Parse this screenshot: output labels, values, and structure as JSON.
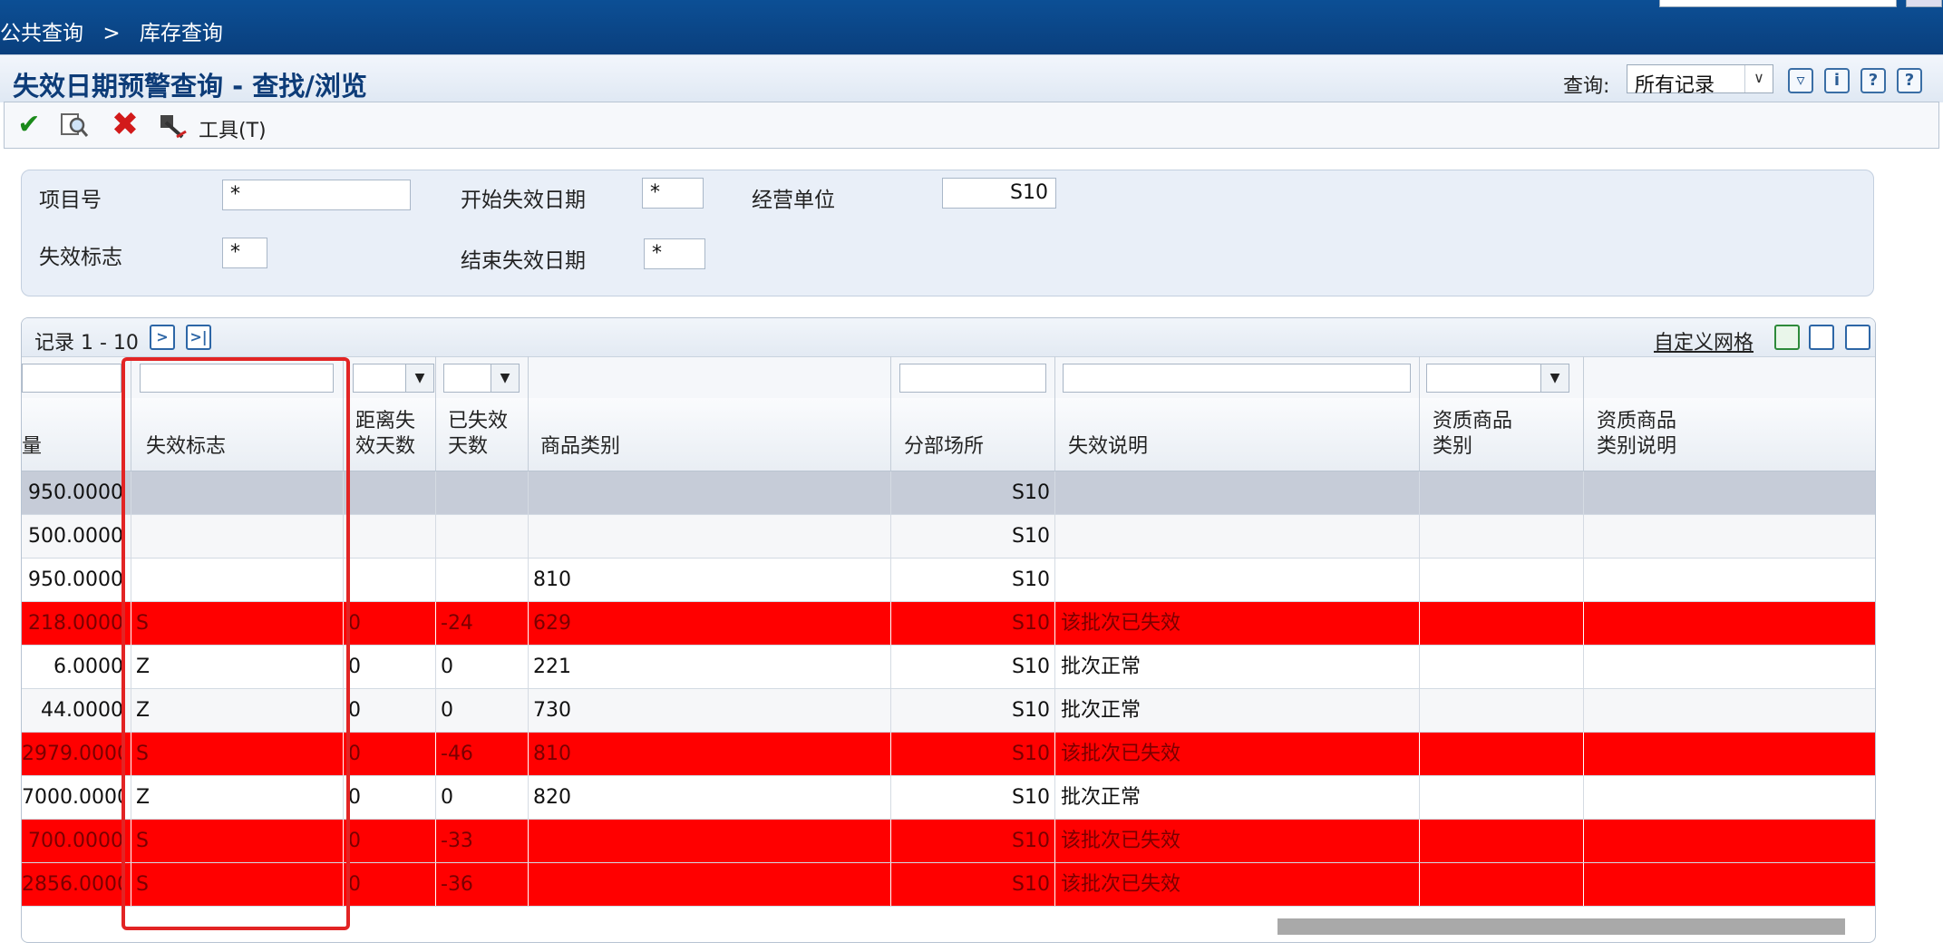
{
  "breadcrumb": {
    "parent": "公共查询",
    "separator": ">",
    "current": "库存查询"
  },
  "form": {
    "title": "失效日期预警查询 - 查找/浏览",
    "query_label": "查询:",
    "query_value": "所有记录",
    "header_icons": [
      "filter-icon",
      "info-icon",
      "help-icon",
      "context-help-icon"
    ]
  },
  "toolbar": {
    "tools_label": "工具(T)"
  },
  "filters": {
    "item_no": {
      "label": "项目号",
      "value": "*"
    },
    "start_date": {
      "label": "开始失效日期",
      "value": "*"
    },
    "business_unit": {
      "label": "经营单位",
      "value": "S10"
    },
    "expiry_flag": {
      "label": "失效标志",
      "value": "*"
    },
    "end_date": {
      "label": "结束失效日期",
      "value": "*"
    }
  },
  "grid": {
    "record_info": "记录 1 - 10",
    "customize_label": "自定义网格",
    "columns": [
      "量",
      "失效标志",
      "距离失\n效天数",
      "已失效\n天数",
      "商品类别",
      "分部场所",
      "失效说明",
      "资质商品\n类别",
      "资质商品\n类别说明"
    ],
    "rows": [
      {
        "qty": "950.0000",
        "flag": "",
        "days_to": "",
        "days_expired": "",
        "category": "",
        "branch": "S10",
        "desc": "",
        "style": "sel"
      },
      {
        "qty": "500.0000",
        "flag": "",
        "days_to": "",
        "days_expired": "",
        "category": "",
        "branch": "S10",
        "desc": "",
        "style": "alt"
      },
      {
        "qty": "950.0000",
        "flag": "",
        "days_to": "",
        "days_expired": "",
        "category": "810",
        "branch": "S10",
        "desc": "",
        "style": "white"
      },
      {
        "qty": "218.0000",
        "flag": "S",
        "days_to": "0",
        "days_expired": "-24",
        "category": "629",
        "branch": "S10",
        "desc": "该批次已失效",
        "style": "red"
      },
      {
        "qty": "6.0000",
        "flag": "Z",
        "days_to": "0",
        "days_expired": "0",
        "category": "221",
        "branch": "S10",
        "desc": "批次正常",
        "style": "white"
      },
      {
        "qty": "44.0000",
        "flag": "Z",
        "days_to": "0",
        "days_expired": "0",
        "category": "730",
        "branch": "S10",
        "desc": "批次正常",
        "style": "alt"
      },
      {
        "qty": "2979.0000",
        "flag": "S",
        "days_to": "0",
        "days_expired": "-46",
        "category": "810",
        "branch": "S10",
        "desc": "该批次已失效",
        "style": "red"
      },
      {
        "qty": "7000.0000",
        "flag": "Z",
        "days_to": "0",
        "days_expired": "0",
        "category": "820",
        "branch": "S10",
        "desc": "批次正常",
        "style": "white"
      },
      {
        "qty": "700.0000",
        "flag": "S",
        "days_to": "0",
        "days_expired": "-33",
        "category": "",
        "branch": "S10",
        "desc": "该批次已失效",
        "style": "red"
      },
      {
        "qty": "2856.0000",
        "flag": "S",
        "days_to": "0",
        "days_expired": "-36",
        "category": "",
        "branch": "S10",
        "desc": "该批次已失效",
        "style": "red"
      }
    ]
  },
  "colors": {
    "expired_row": "#ff0000",
    "highlight_box": "#e22424",
    "title": "#0d3c78"
  }
}
